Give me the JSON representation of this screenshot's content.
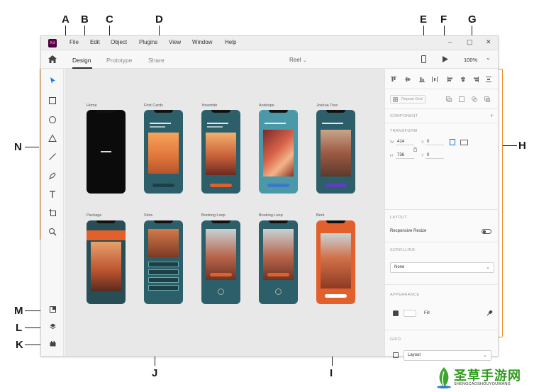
{
  "callouts": {
    "a": "A",
    "b": "B",
    "c": "C",
    "d": "D",
    "e": "E",
    "f": "F",
    "g": "G",
    "h": "H",
    "i": "I",
    "j": "J",
    "k": "K",
    "l": "L",
    "m": "M",
    "n": "N"
  },
  "app": {
    "logo": "Xd",
    "menu": [
      "File",
      "Edit",
      "Object",
      "Plugins",
      "View",
      "Window",
      "Help"
    ],
    "tabs": [
      "Design",
      "Prototype",
      "Share"
    ],
    "doc_title": "Reel",
    "zoom": "100%"
  },
  "artboards": [
    {
      "label": "Home",
      "theme": "black"
    },
    {
      "label": "First Cards",
      "theme": "sunset"
    },
    {
      "label": "Yosemite",
      "theme": "redrock"
    },
    {
      "label": "Antelope",
      "theme": "canyon"
    },
    {
      "label": "Joshua Tree",
      "theme": "joshua"
    },
    {
      "label": "Package",
      "theme": "package"
    },
    {
      "label": "Slots",
      "theme": "slots"
    },
    {
      "label": "Booking Loop",
      "theme": "forest"
    },
    {
      "label": "Booking Loop",
      "theme": "forest2"
    },
    {
      "label": "Bent",
      "theme": "bent"
    }
  ],
  "panel": {
    "repeat_grid": "Repeat Grid",
    "component": "COMPONENT",
    "transform": "TRANSFORM",
    "w_label": "W",
    "w_value": "414",
    "x_label": "X",
    "x_value": "0",
    "h_label": "H",
    "h_value": "736",
    "y_label": "Y",
    "y_value": "0",
    "layout": "LAYOUT",
    "responsive_resize": "Responsive Resize",
    "scrolling": "SCROLLING",
    "scrolling_value": "None",
    "appearance": "APPEARANCE",
    "fill": "Fill",
    "grid": "GRID",
    "grid_value": "Layout"
  },
  "watermark": {
    "title": "圣草手游网",
    "subtitle": "SHENGCAOSHOUYOUWANG"
  },
  "colors": {
    "accent_orange": "#f08a24",
    "xd_logo_bg": "#470137",
    "xd_logo_fg": "#ff61f6",
    "teal": "#2d5f6a"
  }
}
